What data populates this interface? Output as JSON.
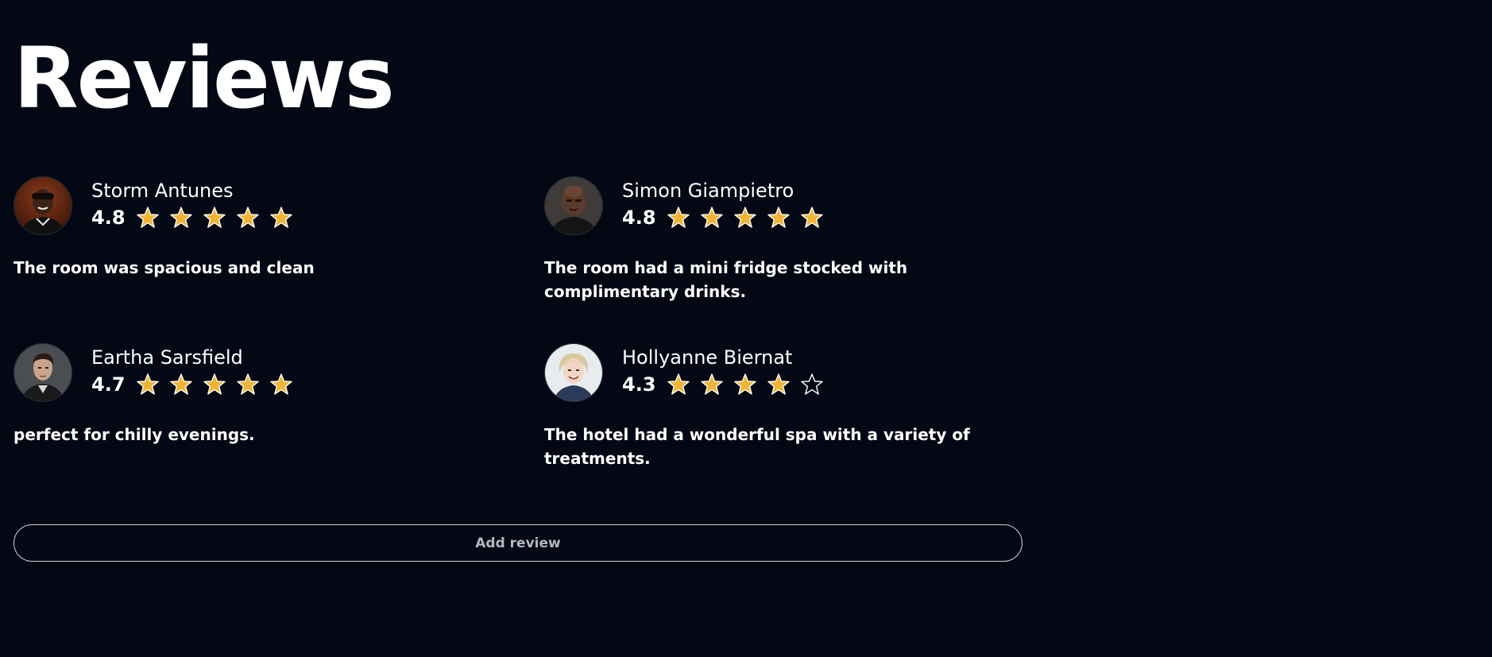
{
  "page": {
    "title": "Reviews",
    "add_review_label": "Add review"
  },
  "colors": {
    "background": "#040814",
    "text": "#ffffff",
    "star_fill": "#f0b435",
    "star_stroke": "#ffffff",
    "button_border": "#cfd3db",
    "button_text": "#b3b7c0"
  },
  "reviews": [
    {
      "name": "Storm Antunes",
      "rating": "4.8",
      "stars": [
        1,
        1,
        1,
        1,
        1
      ],
      "text": "The room was spacious and clean",
      "avatar": "man-dark-skin-smiling"
    },
    {
      "name": "Simon Giampietro",
      "rating": "4.8",
      "stars": [
        1,
        1,
        1,
        1,
        1
      ],
      "text": "The room had a mini fridge stocked with complimentary drinks.",
      "avatar": "man-bald"
    },
    {
      "name": "Eartha Sarsfield",
      "rating": "4.7",
      "stars": [
        1,
        1,
        1,
        1,
        1
      ],
      "text": "perfect for chilly evenings.",
      "avatar": "man-dark-hair"
    },
    {
      "name": "Hollyanne Biernat",
      "rating": "4.3",
      "stars": [
        1,
        1,
        1,
        1,
        0
      ],
      "text": "The hotel had a wonderful spa with a variety of treatments.",
      "avatar": "woman-blonde-short-hair"
    }
  ]
}
